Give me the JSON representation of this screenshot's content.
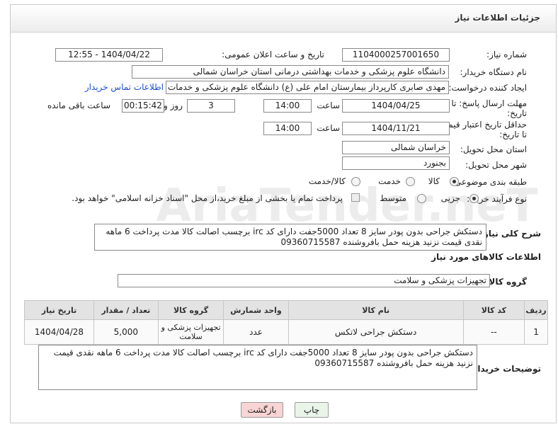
{
  "header": {
    "title": "جزئیات اطلاعات نیاز"
  },
  "fields": {
    "need_number_label": "شماره نیاز:",
    "need_number": "1104000257001650",
    "announce_label": "تاریخ و ساعت اعلان عمومی:",
    "announce_value": "1404/04/22 - 12:55",
    "buyer_org_label": "نام دستگاه خریدار:",
    "buyer_org": "دانشگاه علوم پزشکی و خدمات بهداشتی درمانی استان خراسان شمالی",
    "requester_label": "ایجاد کننده درخواست:",
    "requester": "مهدی صابری کارپرداز بیمارستان امام علی (ع) دانشگاه علوم پزشکی و خدمات ب",
    "buyer_contact_link": "اطلاعات تماس خریدار",
    "deadline_label_line1": "مهلت ارسال پاسخ: تا",
    "deadline_label_line2": "تاریخ:",
    "deadline_date": "1404/04/25",
    "time_label": "ساعت",
    "deadline_time": "14:00",
    "days_value": "3",
    "days_label": "روز و",
    "remaining_time": "00:15:42",
    "remaining_label": "ساعت باقی مانده",
    "validity_label_line1": "حداقل تاریخ اعتبار قیمت:",
    "validity_label_line2": "تا تاریخ:",
    "validity_date": "1404/11/21",
    "validity_time": "14:00",
    "province_label": "استان محل تحویل:",
    "province": "خراسان شمالی",
    "city_label": "شهر محل تحویل:",
    "city": "بجنورد",
    "category_label": "طبقه بندی موضوعی:",
    "category_options": [
      "کالا",
      "خدمت",
      "کالا/خدمت"
    ],
    "category_selected": "کالا",
    "process_label": "نوع فرآیند خرید :",
    "process_options": [
      "جزیی",
      "متوسط"
    ],
    "process_selected": "جزیی",
    "payment_note": "پرداخت تمام یا بخشی از مبلغ خرید،از محل \"اسناد خزانه اسلامی\" خواهد بود.",
    "description_label": "شرح کلی نیاز:",
    "description": "دستکش جراحی بدون پودر سایز 8 تعداد 5000جفت دارای کد irc برچسب اصالت کالا مدت پرداخت 6 ماهه نقدی قیمت نزنید هزینه حمل بافروشنده 09360715587",
    "goods_info_title": "اطلاعات کالاهای مورد نیاز",
    "goods_group_label": "گروه کالا:",
    "goods_group": "تجهیزات پزشکی و سلامت",
    "buyer_notes_label": "توضیحات خریدار:",
    "buyer_notes": "دستکش جراحی بدون پودر سایز 8 تعداد 5000جفت دارای کد irc برچسب اصالت کالا مدت پرداخت 6 ماهه نقدی قیمت نزنید هزینه حمل بافروشنده 09360715587"
  },
  "table": {
    "headers": [
      "ردیف",
      "کد کالا",
      "نام کالا",
      "واحد شمارش",
      "گروه کالا",
      "تعداد / مقدار",
      "تاریخ نیاز"
    ],
    "rows": [
      [
        "1",
        "--",
        "دستکش جراحی لاتکس",
        "عدد",
        "تجهیزات پزشکی و سلامت",
        "5,000",
        "1404/04/28"
      ]
    ]
  },
  "buttons": {
    "print": "چاپ",
    "back": "بازگشت"
  },
  "watermark": {
    "text": "AriaTender.neT"
  },
  "colors": {
    "link": "#1a4fd1",
    "back_button": "#f8d4d4",
    "print_button": "#e9f5e9"
  }
}
